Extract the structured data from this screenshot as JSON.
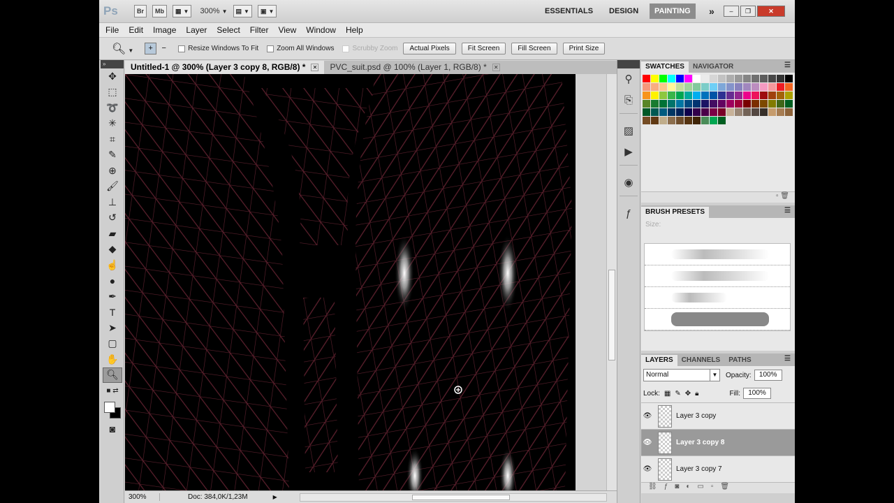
{
  "app": {
    "logo": "Ps",
    "bridge": "Br",
    "minibridge": "Mb",
    "zoom": "300%",
    "workspaces": [
      "ESSENTIALS",
      "DESIGN",
      "PAINTING"
    ],
    "active_workspace": "PAINTING",
    "more": "»"
  },
  "menu": [
    "File",
    "Edit",
    "Image",
    "Layer",
    "Select",
    "Filter",
    "View",
    "Window",
    "Help"
  ],
  "options": {
    "resize_windows": "Resize Windows To Fit",
    "zoom_all": "Zoom All Windows",
    "scrubby": "Scrubby Zoom",
    "actual_pixels": "Actual Pixels",
    "fit_screen": "Fit Screen",
    "fill_screen": "Fill Screen",
    "print_size": "Print Size"
  },
  "tabs": [
    {
      "label": "Untitled-1 @ 300% (Layer 3 copy 8, RGB/8) *",
      "active": true
    },
    {
      "label": "PVC_suit.psd @ 100% (Layer 1, RGB/8) *",
      "active": false
    }
  ],
  "status": {
    "zoom": "300%",
    "doc": "Doc: 384,0K/1,23M"
  },
  "panels": {
    "swatches_tab": "SWATCHES",
    "navigator_tab": "NAVIGATOR",
    "brush_tab": "BRUSH PRESETS",
    "brush_size_label": "Size:",
    "layers_tab": "LAYERS",
    "channels_tab": "CHANNELS",
    "paths_tab": "PATHS",
    "blend_mode": "Normal",
    "opacity_label": "Opacity:",
    "opacity": "100%",
    "lock_label": "Lock:",
    "fill_label": "Fill:",
    "fill": "100%",
    "layers": [
      {
        "name": "Layer 3 copy",
        "selected": false
      },
      {
        "name": "Layer 3 copy 8",
        "selected": true
      },
      {
        "name": "Layer 3 copy 7",
        "selected": false
      }
    ]
  },
  "colors": {
    "swatches": [
      "#ff0000",
      "#ffff00",
      "#00ff00",
      "#00ffff",
      "#0000ff",
      "#ff00ff",
      "#ffffff",
      "#ebebeb",
      "#d6d6d6",
      "#c2c2c2",
      "#adadad",
      "#999999",
      "#858585",
      "#707070",
      "#5c5c5c",
      "#474747",
      "#333333",
      "#000000",
      "#f7977a",
      "#f9ad81",
      "#fdc68a",
      "#fff79a",
      "#c4df9b",
      "#a2d39c",
      "#82ca9d",
      "#7bcdc8",
      "#6ecff6",
      "#7ea7d8",
      "#8493ca",
      "#8882be",
      "#a187be",
      "#bc8dbf",
      "#f49ac2",
      "#f6989d",
      "#ed1c24",
      "#f26522",
      "#f7941d",
      "#fff200",
      "#8dc73f",
      "#39b54a",
      "#00a651",
      "#00a99d",
      "#00aeef",
      "#0072bc",
      "#0054a6",
      "#2e3192",
      "#662d91",
      "#92278f",
      "#ec008c",
      "#ed145b",
      "#9e0b0f",
      "#a0410d",
      "#a3620a",
      "#aba000",
      "#598527",
      "#197b30",
      "#007236",
      "#00746b",
      "#0076a3",
      "#004a80",
      "#003471",
      "#1b1464",
      "#440e62",
      "#630460",
      "#9e005d",
      "#9e0039",
      "#790000",
      "#7b2e00",
      "#7d4900",
      "#827b00",
      "#406618",
      "#005e20",
      "#005826",
      "#005952",
      "#005b7f",
      "#003663",
      "#002157",
      "#0d004c",
      "#32004b",
      "#4b0049",
      "#7b0046",
      "#7a0026",
      "#c7b299",
      "#998675",
      "#736357",
      "#534741",
      "#37302a",
      "#c69c6d",
      "#a67c52",
      "#8c6239",
      "#754c24",
      "#603913",
      "#c0ad8b",
      "#8c6e4d",
      "#6e4d2c",
      "#553310",
      "#3f2406",
      "#4a8c58",
      "#00a651",
      "#005e20"
    ]
  }
}
